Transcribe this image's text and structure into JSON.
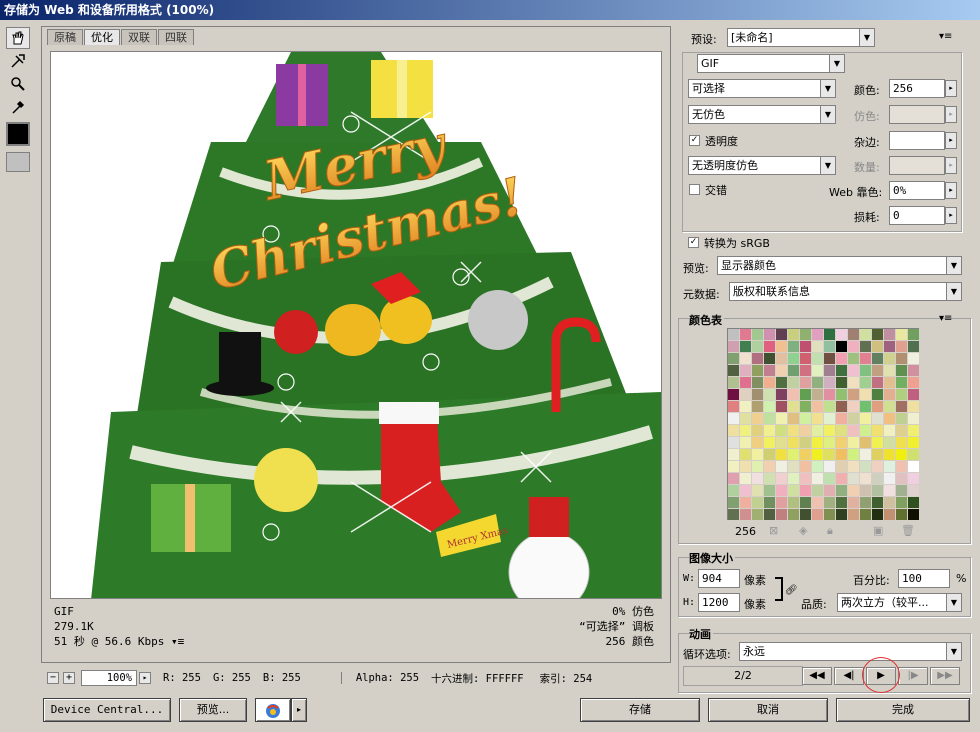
{
  "window": {
    "title": "存储为 Web 和设备所用格式 (100%)"
  },
  "tabs": [
    "原稿",
    "优化",
    "双联",
    "四联"
  ],
  "image_text": {
    "merry": "Merry",
    "christmas": "Christmas!",
    "banner": "Merry Xmas"
  },
  "info": {
    "format": "GIF",
    "size": "279.1K",
    "time": "51 秒 @ 56.6 Kbps",
    "dither": "0% 仿色",
    "palette": "“可选择” 调板",
    "colors": "256 颜色"
  },
  "status": {
    "zoom": "100%",
    "r": "R: 255",
    "g": "G: 255",
    "b": "B: 255",
    "alpha": "Alpha: 255",
    "hex": "十六进制: FFFFFF",
    "index": "索引: 254"
  },
  "buttons": {
    "device_central": "Device Central...",
    "preview": "预览...",
    "save": "存储",
    "cancel": "取消",
    "done": "完成"
  },
  "settings": {
    "preset_label": "预设:",
    "preset_value": "[未命名]",
    "format_value": "GIF",
    "reduction": "可选择",
    "colors_label": "颜色:",
    "colors_value": "256",
    "dither_algo": "无仿色",
    "dither_label": "仿色:",
    "transparency_label": "透明度",
    "matte_label": "杂边:",
    "transparency_dither": "无透明度仿色",
    "amount_label": "数量:",
    "interlaced_label": "交错",
    "web_snap_label": "Web 靠色:",
    "web_snap_value": "0%",
    "lossy_label": "损耗:",
    "lossy_value": "0",
    "convert_srgb_label": "转换为 sRGB",
    "preview_label": "预览:",
    "preview_value": "显示器颜色",
    "metadata_label": "元数据:",
    "metadata_value": "版权和联系信息"
  },
  "color_table": {
    "title": "颜色表",
    "count": "256",
    "colors": [
      "#c0c0c0",
      "#e07a90",
      "#a0c890",
      "#d090b0",
      "#604050",
      "#c8d080",
      "#90b070",
      "#e0a0c0",
      "#307040",
      "#f0d0e0",
      "#a08070",
      "#d0e0a0",
      "#506030",
      "#c090a0",
      "#e8e8a0",
      "#70a060",
      "#d0a0b0",
      "#408050",
      "#b0d0a0",
      "#e06080",
      "#f0c090",
      "#80b080",
      "#c05070",
      "#e0e0c0",
      "#90c0a0",
      "#000000",
      "#f0b0c0",
      "#607050",
      "#d0c080",
      "#a06080",
      "#e0a090",
      "#507050",
      "#80a070",
      "#f0e0d0",
      "#b07080",
      "#405030",
      "#e0c0a0",
      "#90d090",
      "#d06070",
      "#c0e0b0",
      "#705040",
      "#f0a0b0",
      "#a0c080",
      "#e08090",
      "#608060",
      "#d0d090",
      "#b09070",
      "#f0f0e0",
      "#506040",
      "#e0b0c0",
      "#90a060",
      "#c08090",
      "#f0d0b0",
      "#70a070",
      "#d07080",
      "#e0f0c0",
      "#a08090",
      "#407040",
      "#f0c0d0",
      "#80c080",
      "#c0a080",
      "#e0e0b0",
      "#609050",
      "#d090a0",
      "#b0c090",
      "#e07090",
      "#809060",
      "#f0b090",
      "#507040",
      "#c0d0a0",
      "#e0a0a0",
      "#90b080",
      "#d0b0c0",
      "#406030",
      "#f0e0c0",
      "#a0d090",
      "#c07080",
      "#e0c090",
      "#70b060",
      "#f0a090",
      "#701040",
      "#e0d0c0",
      "#a09070",
      "#d0e0b0",
      "#804060",
      "#f0c0b0",
      "#60a050",
      "#c0b090",
      "#e090a0",
      "#90c070",
      "#d0a080",
      "#f0e0b0",
      "#508040",
      "#e0b090",
      "#b0d080",
      "#c06080",
      "#e08080",
      "#f0f0c0",
      "#b0a070",
      "#d0f0b0",
      "#a05060",
      "#e0e090",
      "#80b060",
      "#f0c0a0",
      "#c0e090",
      "#906050",
      "#f0d0c0",
      "#70c070",
      "#e0a080",
      "#d0e090",
      "#a07060",
      "#f0e0a0",
      "#f0f0f0",
      "#e0e0a0",
      "#f0d090",
      "#c0e0a0",
      "#f0f0b0",
      "#e0c080",
      "#d0f0a0",
      "#f0e090",
      "#e0f0d0",
      "#f0b0a0",
      "#d0d0a0",
      "#f0f0a0",
      "#e0e0d0",
      "#f0c080",
      "#c0d090",
      "#f0f0d0",
      "#f0e0a0",
      "#f0f080",
      "#e0d080",
      "#f0f090",
      "#d0e080",
      "#f0e080",
      "#f0d0a0",
      "#e0f0a0",
      "#f0f060",
      "#e0e080",
      "#f0c0c0",
      "#d0f090",
      "#f0e070",
      "#f0f0c0",
      "#e0d090",
      "#f0f070",
      "#e0e0e0",
      "#f0f0b0",
      "#f0d080",
      "#f0f060",
      "#e0e090",
      "#f0e060",
      "#d0d080",
      "#f0f040",
      "#e0f080",
      "#f0d070",
      "#f0f0a0",
      "#e0c070",
      "#f0f050",
      "#d0e0a0",
      "#f0e050",
      "#f0f030",
      "#f0f0d0",
      "#e0e070",
      "#f0f0a0",
      "#d0d070",
      "#f0e040",
      "#e0f070",
      "#f0d060",
      "#f0f020",
      "#e0e060",
      "#f0c060",
      "#d0f080",
      "#f0f0e0",
      "#e0d060",
      "#f0e030",
      "#f0f010",
      "#d0e070",
      "#f0f0c0",
      "#f0e0b0",
      "#e0f0b0",
      "#f0d0b0",
      "#f0f0e0",
      "#e0e0c0",
      "#f0c0a0",
      "#d0f0c0",
      "#f0f0f0",
      "#e0d0b0",
      "#f0e0c0",
      "#d0e0c0",
      "#f0d0c0",
      "#e0f0e0",
      "#f0c0b0",
      "#ffffff",
      "#e0a0b0",
      "#f0f0d0",
      "#f0e0e0",
      "#d0e0b0",
      "#f0d0d0",
      "#e0f0c0",
      "#f0c0c0",
      "#f0f0e0",
      "#c0e0b0",
      "#f0b0b0",
      "#e0e0d0",
      "#f0e0d0",
      "#d0d0c0",
      "#f0f0f0",
      "#e0c0c0",
      "#f0d0e0",
      "#b0d0a0",
      "#f0c0d0",
      "#e0e0b0",
      "#a0c090",
      "#f0b0c0",
      "#d0e0a0",
      "#f0a0b0",
      "#c0d0a0",
      "#e0b0b0",
      "#90b080",
      "#f0d0b0",
      "#d0c0b0",
      "#b0c0a0",
      "#f0e0e0",
      "#a0b090",
      "#e0d0d0",
      "#80a070",
      "#f0b0a0",
      "#c0d090",
      "#709060",
      "#e0a0a0",
      "#b0c080",
      "#608050",
      "#f0c0b0",
      "#a0b080",
      "#507040",
      "#e0b0a0",
      "#90a070",
      "#406030",
      "#d0c0a0",
      "#80a060",
      "#305020",
      "#607050",
      "#d09090",
      "#a0b070",
      "#506040",
      "#c08080",
      "#90a060",
      "#405030",
      "#e0a090",
      "#809050",
      "#304020",
      "#d0a080",
      "#708040",
      "#203010",
      "#c09070",
      "#607030",
      "#101000"
    ]
  },
  "image_size": {
    "title": "图像大小",
    "w_label": "W:",
    "w_value": "904",
    "h_label": "H:",
    "h_value": "1200",
    "unit": "像素",
    "percent_label": "百分比:",
    "percent_value": "100",
    "percent_unit": "%",
    "quality_label": "品质:",
    "quality_value": "两次立方（较平..."
  },
  "animation": {
    "title": "动画",
    "loop_label": "循环选项:",
    "loop_value": "永远",
    "frame": "2/2"
  }
}
